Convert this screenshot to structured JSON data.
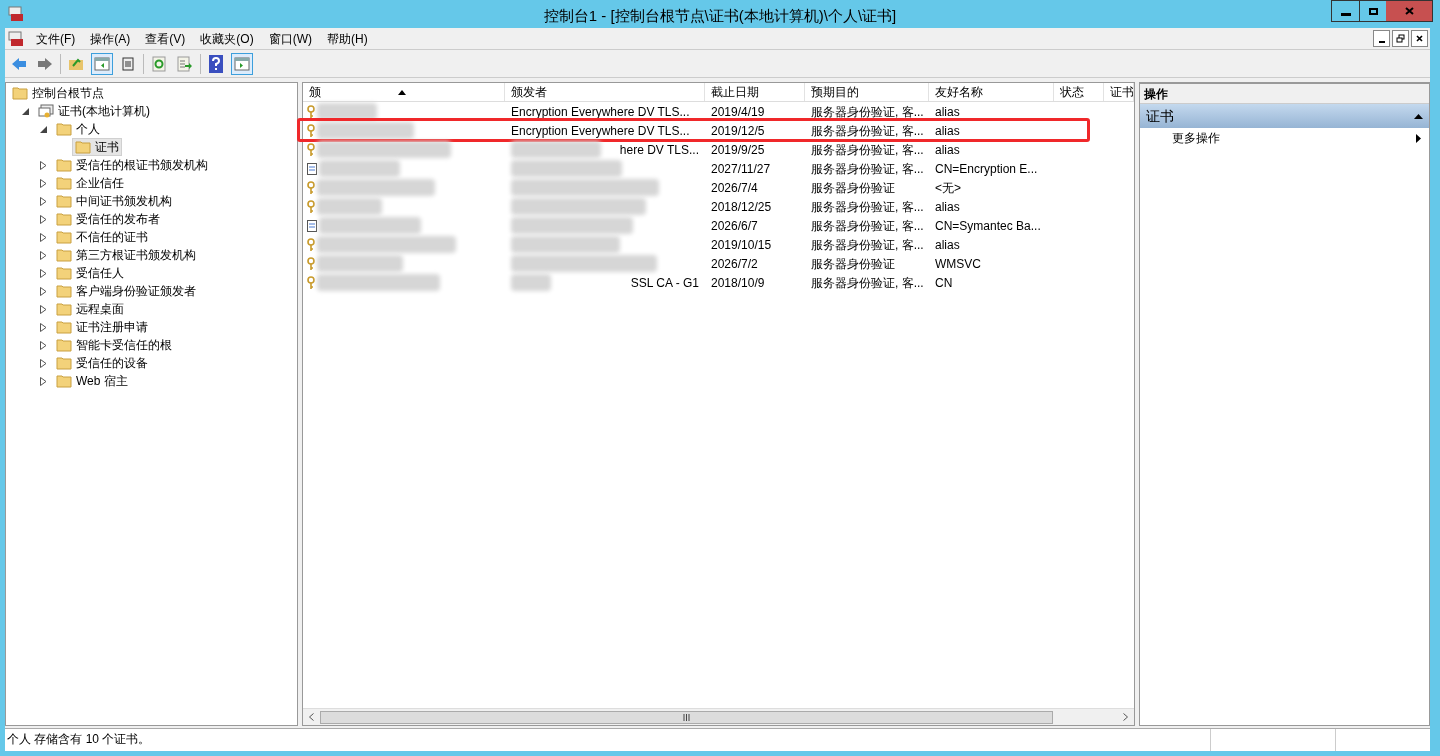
{
  "window": {
    "title": "控制台1 - [控制台根节点\\证书(本地计算机)\\个人\\证书]"
  },
  "menu": [
    "文件(F)",
    "操作(A)",
    "查看(V)",
    "收藏夹(O)",
    "窗口(W)",
    "帮助(H)"
  ],
  "tree": [
    {
      "label": "控制台根节点",
      "kind": "folder",
      "selected": false,
      "children": [
        {
          "label": "证书(本地计算机)",
          "kind": "computer",
          "selected": false,
          "expanded": true,
          "children": [
            {
              "label": "个人",
              "kind": "folder",
              "selected": false,
              "expanded": true,
              "children": [
                {
                  "label": "证书",
                  "kind": "folder",
                  "selected": true
                }
              ]
            },
            {
              "label": "受信任的根证书颁发机构",
              "kind": "folder",
              "selected": false,
              "expanded": false
            },
            {
              "label": "企业信任",
              "kind": "folder",
              "selected": false,
              "expanded": false
            },
            {
              "label": "中间证书颁发机构",
              "kind": "folder",
              "selected": false,
              "expanded": false
            },
            {
              "label": "受信任的发布者",
              "kind": "folder",
              "selected": false,
              "expanded": false
            },
            {
              "label": "不信任的证书",
              "kind": "folder",
              "selected": false,
              "expanded": false
            },
            {
              "label": "第三方根证书颁发机构",
              "kind": "folder",
              "selected": false,
              "expanded": false
            },
            {
              "label": "受信任人",
              "kind": "folder",
              "selected": false,
              "expanded": false
            },
            {
              "label": "客户端身份验证颁发者",
              "kind": "folder",
              "selected": false,
              "expanded": false
            },
            {
              "label": "远程桌面",
              "kind": "folder",
              "selected": false,
              "expanded": false
            },
            {
              "label": "证书注册申请",
              "kind": "folder",
              "selected": false,
              "expanded": false
            },
            {
              "label": "智能卡受信任的根",
              "kind": "folder",
              "selected": false,
              "expanded": false
            },
            {
              "label": "受信任的设备",
              "kind": "folder",
              "selected": false,
              "expanded": false
            },
            {
              "label": "Web 宿主",
              "kind": "folder",
              "selected": false,
              "expanded": false
            }
          ]
        }
      ]
    }
  ],
  "table": {
    "columns": [
      "颁",
      "颁发者",
      "截止日期",
      "预期目的",
      "友好名称",
      "状态",
      "证书"
    ],
    "rows": [
      {
        "kind": "key",
        "highlighted": false,
        "issuer": "Encryption Everywhere DV TLS...",
        "expires": "2019/4/19",
        "purpose": "服务器身份验证, 客...",
        "friendly_name": "alias"
      },
      {
        "kind": "key",
        "highlighted": true,
        "issuer": "Encryption Everywhere DV TLS...",
        "expires": "2019/12/5",
        "purpose": "服务器身份验证, 客...",
        "friendly_name": "alias"
      },
      {
        "kind": "key",
        "highlighted": false,
        "issuer": "here DV TLS...",
        "expires": "2019/9/25",
        "purpose": "服务器身份验证, 客...",
        "friendly_name": "alias"
      },
      {
        "kind": "cert",
        "highlighted": false,
        "expires": "2027/11/27",
        "purpose": "服务器身份验证, 客...",
        "friendly_name": "CN=Encryption E..."
      },
      {
        "kind": "key",
        "highlighted": false,
        "expires": "2026/7/4",
        "purpose": "服务器身份验证",
        "friendly_name": "<无>"
      },
      {
        "kind": "key",
        "highlighted": false,
        "expires": "2018/12/25",
        "purpose": "服务器身份验证, 客...",
        "friendly_name": "alias"
      },
      {
        "kind": "cert",
        "highlighted": false,
        "expires": "2026/6/7",
        "purpose": "服务器身份验证, 客...",
        "friendly_name": "CN=Symantec Ba..."
      },
      {
        "kind": "key",
        "highlighted": false,
        "expires": "2019/10/15",
        "purpose": "服务器身份验证, 客...",
        "friendly_name": "alias"
      },
      {
        "kind": "key",
        "highlighted": false,
        "expires": "2026/7/2",
        "purpose": "服务器身份验证",
        "friendly_name": "WMSVC"
      },
      {
        "kind": "key",
        "highlighted": false,
        "issuer": "SSL CA - G1",
        "expires": "2018/10/9",
        "purpose": "服务器身份验证, 客...",
        "friendly_name": "CN"
      }
    ]
  },
  "actions": {
    "header": "操作",
    "section": "证书",
    "expanded": true,
    "items": [
      "更多操作"
    ]
  },
  "status_bar": {
    "text": "个人 存储含有 10 个证书。"
  }
}
